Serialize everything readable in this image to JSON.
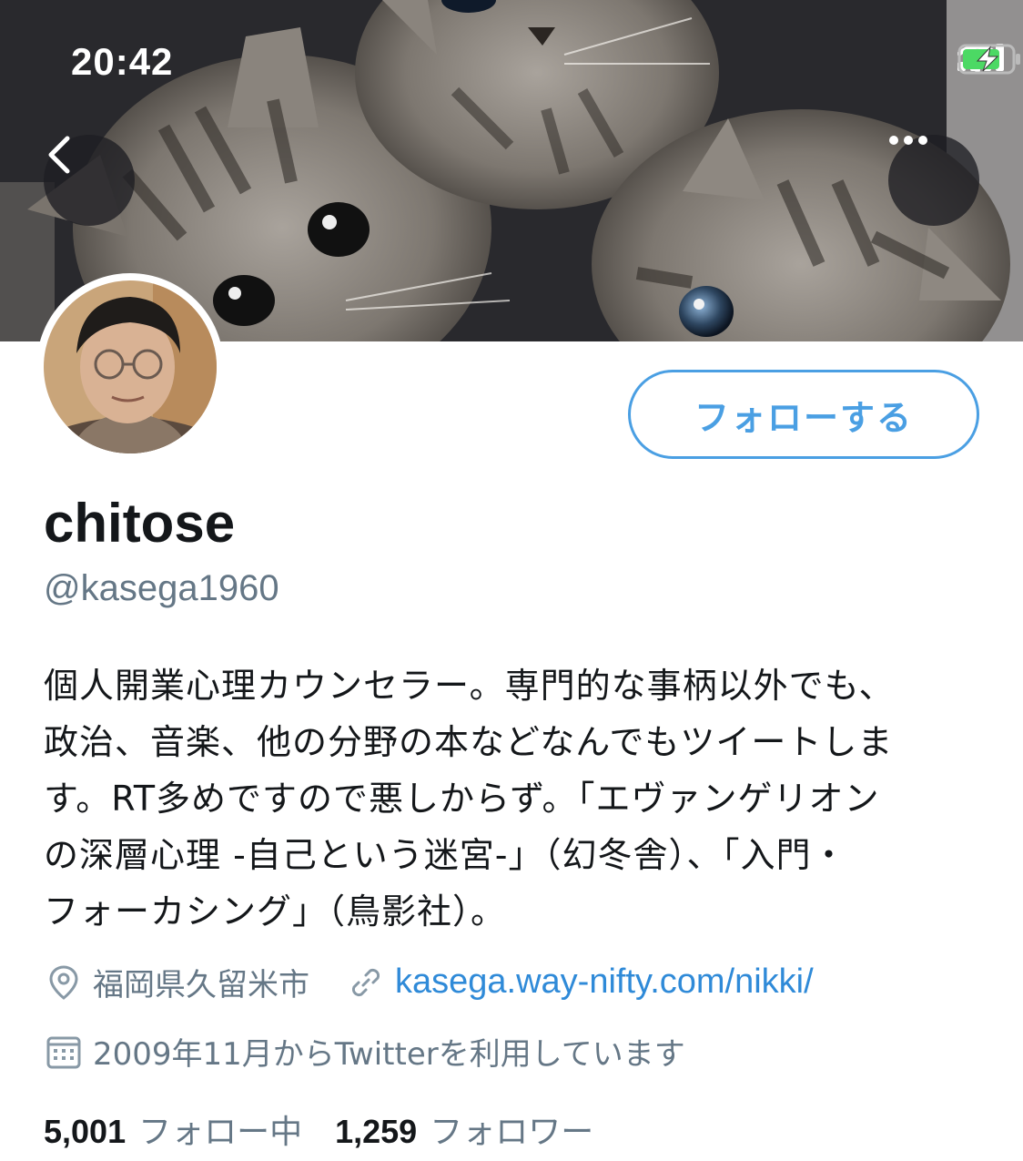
{
  "status_bar": {
    "time": "20:42",
    "icons": [
      "signal-icon",
      "wifi-icon",
      "battery-charging-icon"
    ],
    "battery_color": "#4cd964"
  },
  "header": {
    "back_icon": "chevron-left-icon",
    "more_icon": "more-horizontal-icon"
  },
  "profile": {
    "name": "chitose",
    "handle": "@kasega1960",
    "follow_label": "フォローする",
    "bio_lines": [
      "個人開業心理カウンセラー。専門的な事柄以外でも、",
      "政治、音楽、他の分野の本などなんでもツイートしま",
      "す。RT多めですので悪しからず。「エヴァンゲリオン",
      "の深層心理 -自己という迷宮-」（幻冬舎）、「入門・",
      "フォーカシング」（鳥影社）。"
    ],
    "location": "福岡県久留米市",
    "url": "kasega.way-nifty.com/nikki/",
    "joined": "2009年11月からTwitterを利用しています",
    "following_count": "5,001",
    "following_label": "フォロー中",
    "followers_count": "1,259",
    "followers_label": "フォロワー"
  },
  "colors": {
    "accent": "#4a9fe3",
    "link": "#2f8ad8",
    "secondary_text": "#657786",
    "primary_text": "#14171a"
  }
}
